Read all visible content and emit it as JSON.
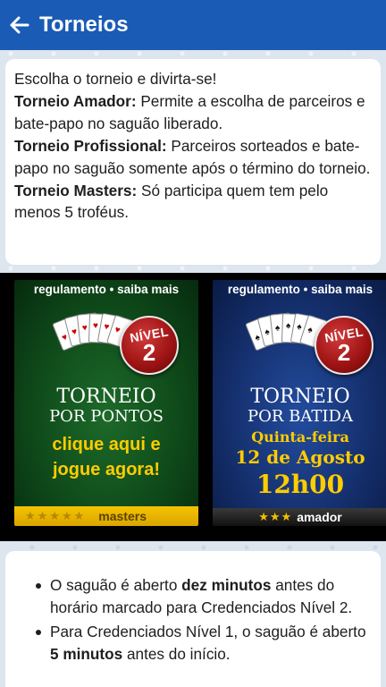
{
  "header": {
    "title": "Torneios",
    "back_icon": "arrow-left-icon"
  },
  "intro": {
    "line1": "Escolha o torneio e divirta-se!",
    "amador_label": "Torneio Amador:",
    "amador_text": " Permite a escolha de parceiros e bate-papo no saguão liberado.",
    "profissional_label": "Torneio Profissional:",
    "profissional_text": " Parceiros sorteados e bate-papo no saguão somente após o término do torneio.",
    "masters_label": "Torneio Masters:",
    "masters_text": " Só participa quem tem pelo menos 5 troféus."
  },
  "banners": [
    {
      "link": "regulamento • saiba mais",
      "nivel_label": "NÍVEL",
      "nivel_number": "2",
      "title_line1": "TORNEIO",
      "title_line2": "POR PONTOS",
      "cta_line1": "clique aqui e",
      "cta_line2": "jogue agora!",
      "stars": "★★★★★",
      "category": "masters",
      "bg_color": "#0f4a1a",
      "footer_color": "#f5c400"
    },
    {
      "link": "regulamento • saiba mais",
      "nivel_label": "NÍVEL",
      "nivel_number": "2",
      "title_line1": "TORNEIO",
      "title_line2": "POR BATIDA",
      "day": "Quinta-feira",
      "date": "12 de Agosto",
      "time": "12h00",
      "stars": "★★★",
      "category": "amador",
      "bg_color": "#15306e",
      "footer_color": "#222222"
    }
  ],
  "info": {
    "item1_pre": "O saguão é aberto ",
    "item1_bold": "dez minutos",
    "item1_post": " antes do horário marcado para Credenciados Nível 2.",
    "item2_pre": "Para Credenciados Nível 1, o saguão é aberto ",
    "item2_bold": "5 minutos",
    "item2_post": " antes do início."
  },
  "colors": {
    "accent": "#1a5bb5",
    "cta_yellow": "#ffcc00",
    "badge_red": "#b01818"
  }
}
